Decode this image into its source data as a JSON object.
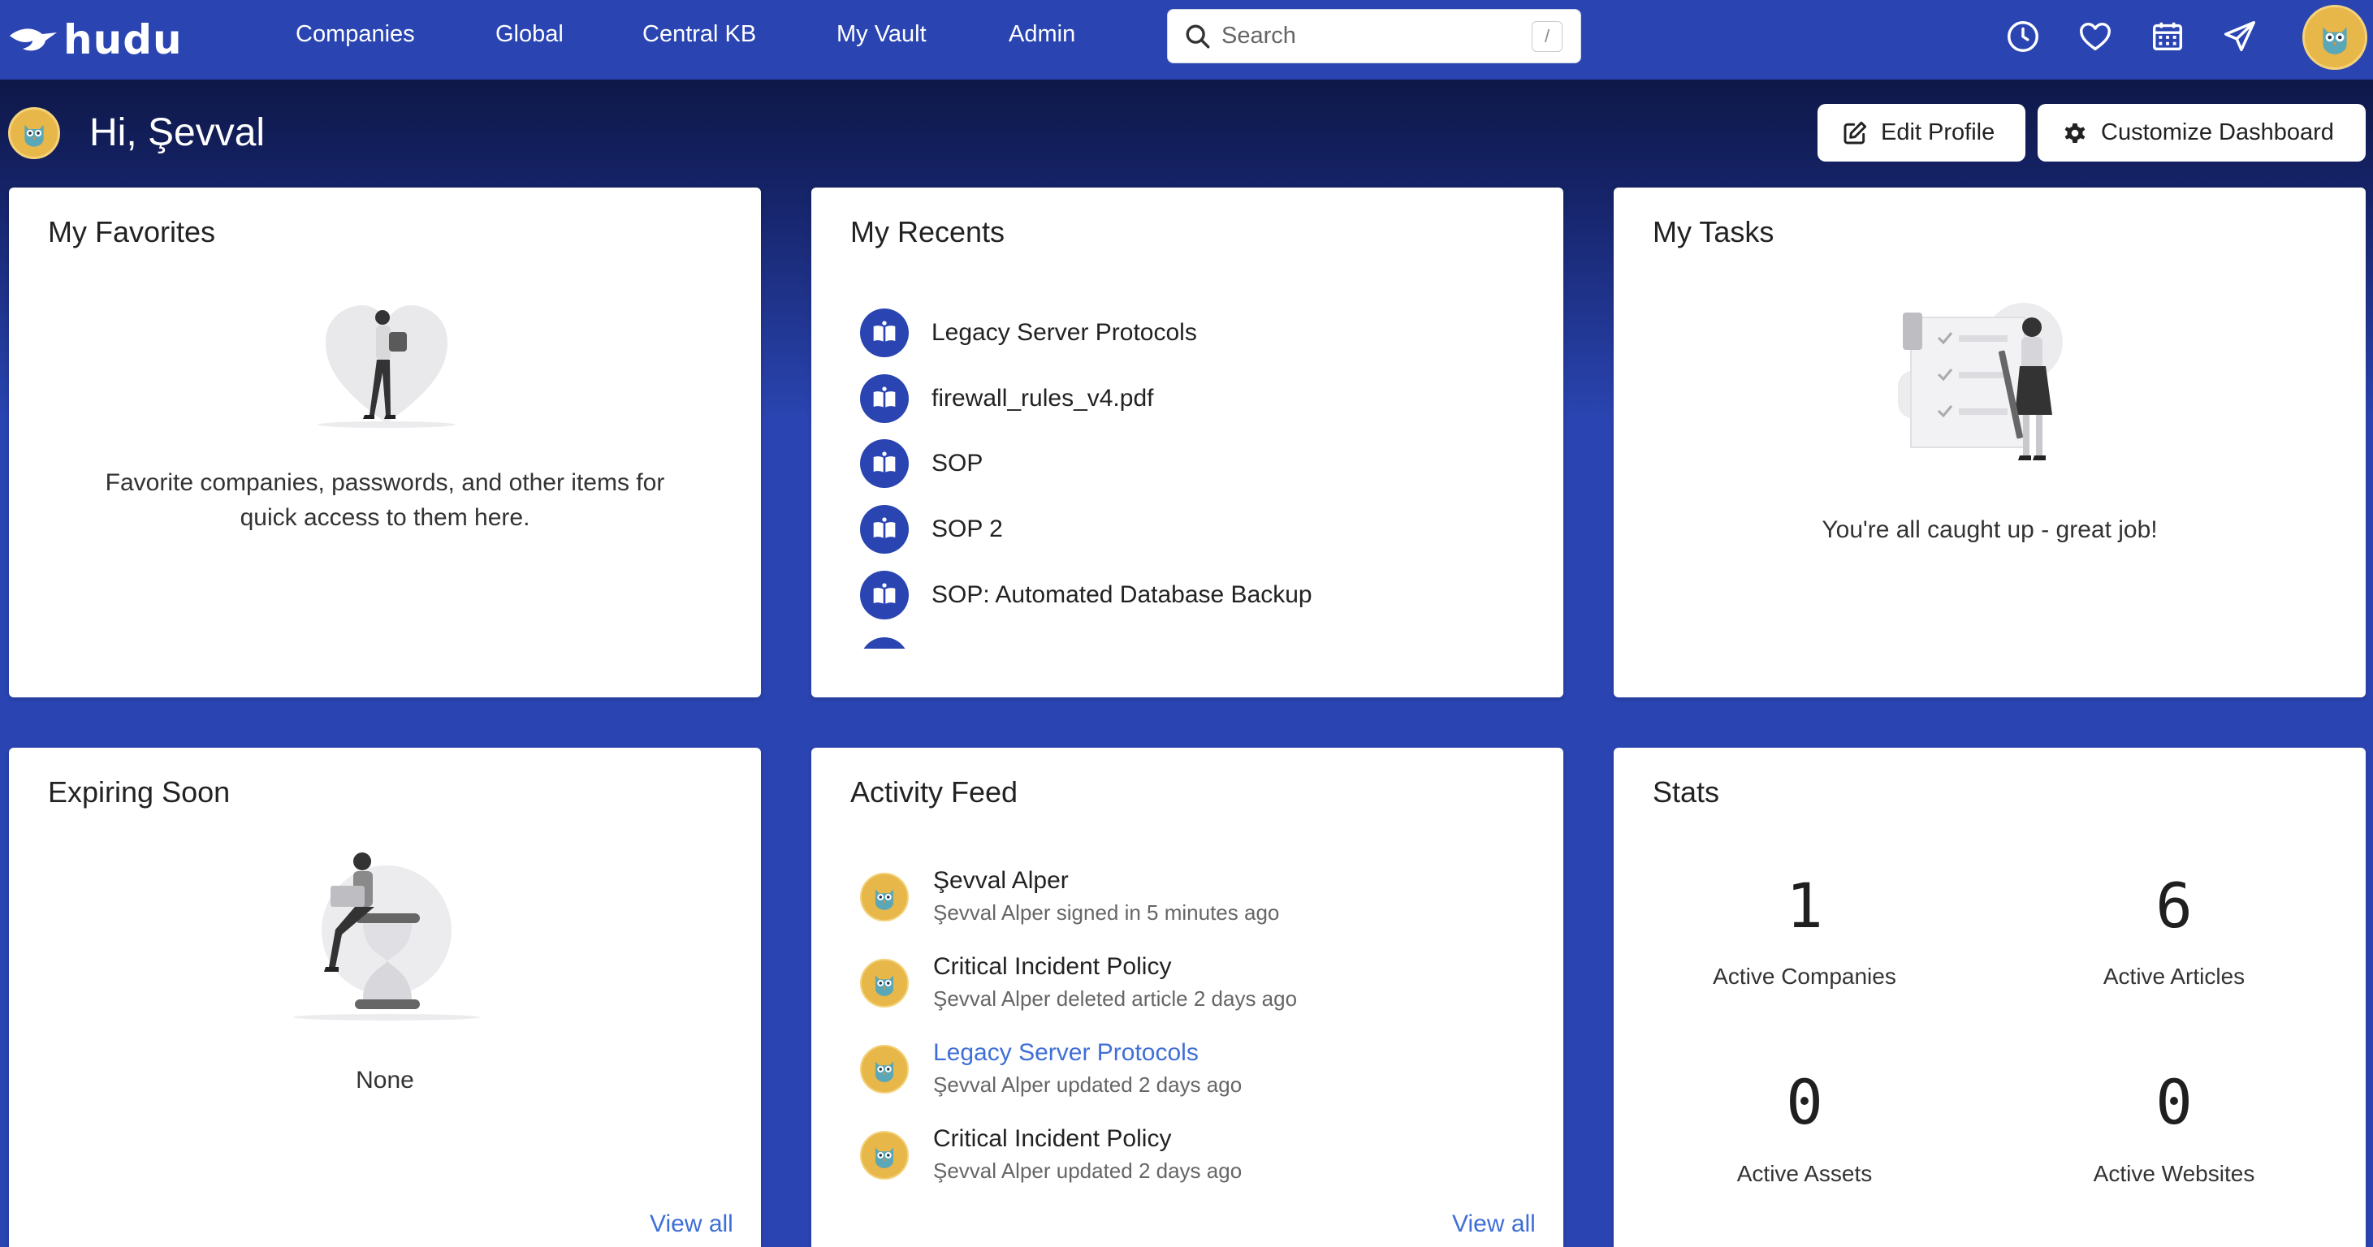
{
  "nav": {
    "brand": "hudu",
    "links": [
      "Companies",
      "Global",
      "Central KB",
      "My Vault",
      "Admin"
    ],
    "search_placeholder": "Search",
    "search_shortcut": "/",
    "icons": [
      "clock-icon",
      "heart-icon",
      "calendar-icon",
      "send-icon"
    ]
  },
  "header": {
    "greeting": "Hi, Şevval",
    "edit_profile": "Edit Profile",
    "customize": "Customize Dashboard"
  },
  "favorites": {
    "title": "My Favorites",
    "empty_line1": "Favorite companies, passwords, and other items for",
    "empty_line2": "quick access to them here."
  },
  "recents": {
    "title": "My Recents",
    "items": [
      "Legacy Server Protocols",
      "firewall_rules_v4.pdf",
      "SOP",
      "SOP 2",
      "SOP: Automated Database Backup"
    ]
  },
  "tasks": {
    "title": "My Tasks",
    "empty": "You're all caught up - great job!"
  },
  "expiring": {
    "title": "Expiring Soon",
    "empty": "None",
    "view_all": "View all"
  },
  "feed": {
    "title": "Activity Feed",
    "items": [
      {
        "title": "Şevval Alper",
        "sub": "Şevval Alper signed in 5 minutes ago"
      },
      {
        "title": "Critical Incident Policy",
        "sub": "Şevval Alper deleted article 2 days ago"
      },
      {
        "title": "Legacy Server Protocols",
        "sub": "Şevval Alper updated 2 days ago"
      },
      {
        "title": "Critical Incident Policy",
        "sub": "Şevval Alper updated 2 days ago"
      }
    ],
    "view_all": "View all"
  },
  "stats": {
    "title": "Stats",
    "items": [
      {
        "value": "1",
        "label": "Active Companies"
      },
      {
        "value": "6",
        "label": "Active Articles"
      },
      {
        "value": "0",
        "label": "Active Assets"
      },
      {
        "value": "0",
        "label": "Active Websites"
      }
    ]
  },
  "colors": {
    "brand_blue": "#2a45b2",
    "link_blue": "#3f6fd6",
    "avatar_gold": "#e8b74a"
  }
}
